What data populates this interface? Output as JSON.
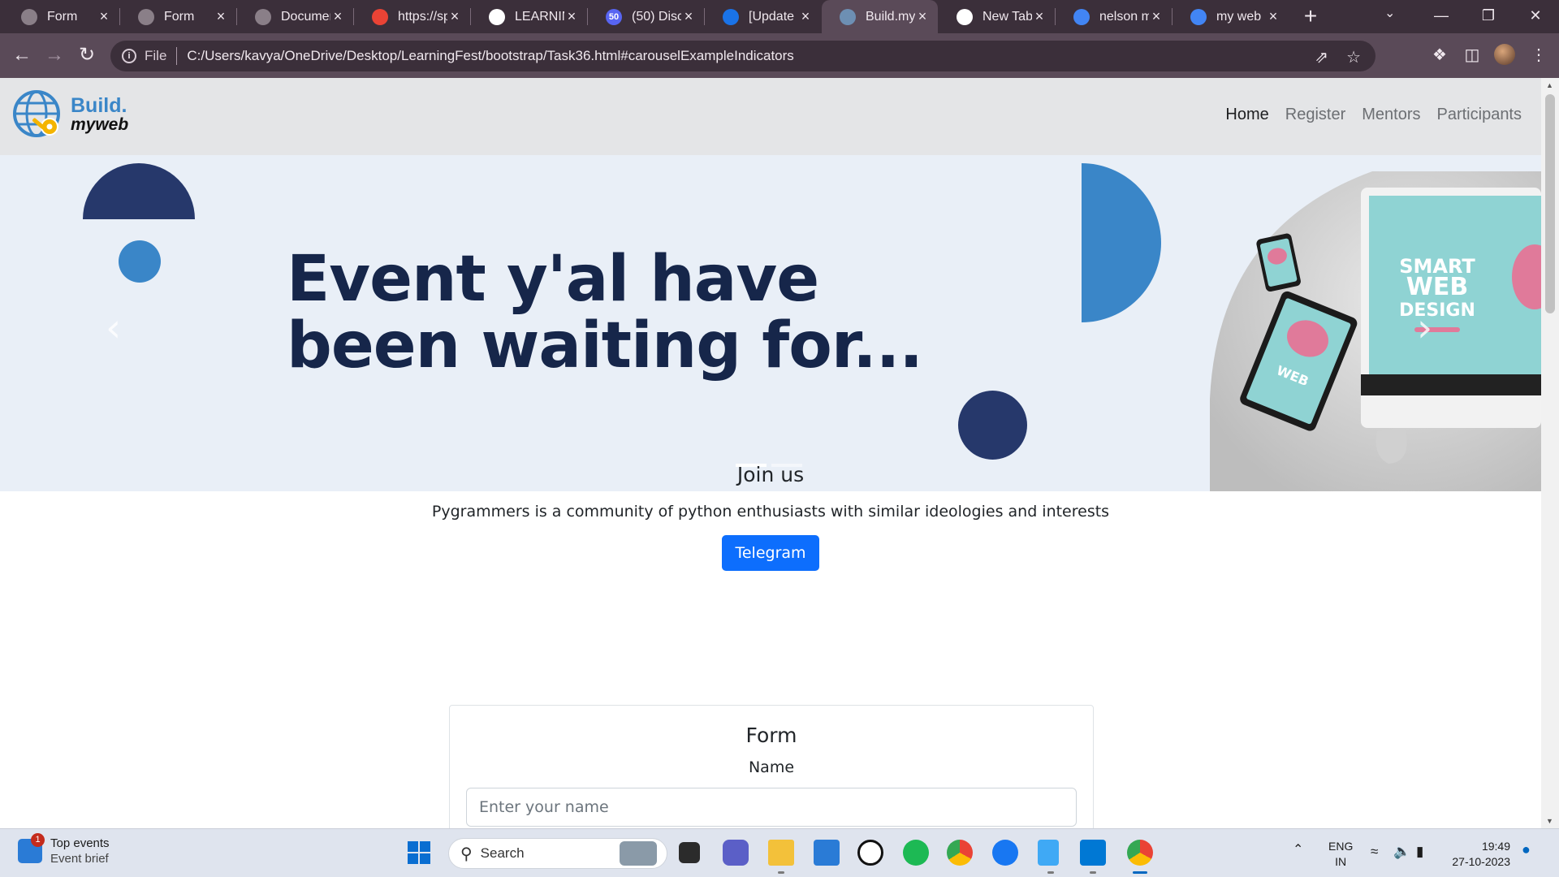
{
  "browser": {
    "tabs": [
      {
        "title": "Form",
        "icon": "globe-icon",
        "color": "#8a7f88"
      },
      {
        "title": "Form",
        "icon": "globe-icon",
        "color": "#8a7f88"
      },
      {
        "title": "Documen",
        "icon": "globe-icon",
        "color": "#8a7f88"
      },
      {
        "title": "https://sp",
        "icon": "gmail-icon",
        "color": "#ea4335"
      },
      {
        "title": "LEARNIN",
        "icon": "notion-icon",
        "color": "#ffffff"
      },
      {
        "title": "(50) Disc",
        "icon": "discord-icon",
        "color": "#5865f2"
      },
      {
        "title": "[Update",
        "icon": "app-icon",
        "color": "#1a73e8"
      },
      {
        "title": "Build.my",
        "icon": "site-icon",
        "color": "#6d8fb3"
      },
      {
        "title": "New Tab",
        "icon": "chrome-icon",
        "color": "#ffffff"
      },
      {
        "title": "nelson m",
        "icon": "google-icon",
        "color": "#4285f4"
      },
      {
        "title": "my web",
        "icon": "google-icon",
        "color": "#4285f4"
      }
    ],
    "active_tab": 7,
    "discord_badge": "50",
    "address": {
      "scheme_label": "File",
      "url": "C:/Users/kavya/OneDrive/Desktop/LearningFest/bootstrap/Task36.html#carouselExampleIndicators"
    }
  },
  "site": {
    "logo": {
      "line1": "Build.",
      "line2": "myweb"
    },
    "nav": [
      {
        "label": "Home",
        "active": true
      },
      {
        "label": "Register",
        "active": false
      },
      {
        "label": "Mentors",
        "active": false
      },
      {
        "label": "Participants",
        "active": false
      }
    ],
    "hero": {
      "title": "Event y'al have\nbeen waiting for...",
      "mockup_text": "SMART WEB DESIGN",
      "slides": 2,
      "active_slide": 0,
      "colors": {
        "dark": "#26386b",
        "blue": "#3a86c8",
        "bg": "#e9eff7"
      }
    },
    "join": {
      "heading": "Join us",
      "text": "Pygrammers is a community of python enthusiasts with similar ideologies and interests",
      "button": "Telegram"
    },
    "form": {
      "title": "Form",
      "name_label": "Name",
      "name_placeholder": "Enter your name"
    }
  },
  "taskbar": {
    "widget": {
      "title": "Top events",
      "subtitle": "Event brief",
      "badge": "1"
    },
    "search_label": "Search",
    "tray": {
      "lang1": "ENG",
      "lang2": "IN",
      "time": "19:49",
      "date": "27-10-2023"
    }
  }
}
